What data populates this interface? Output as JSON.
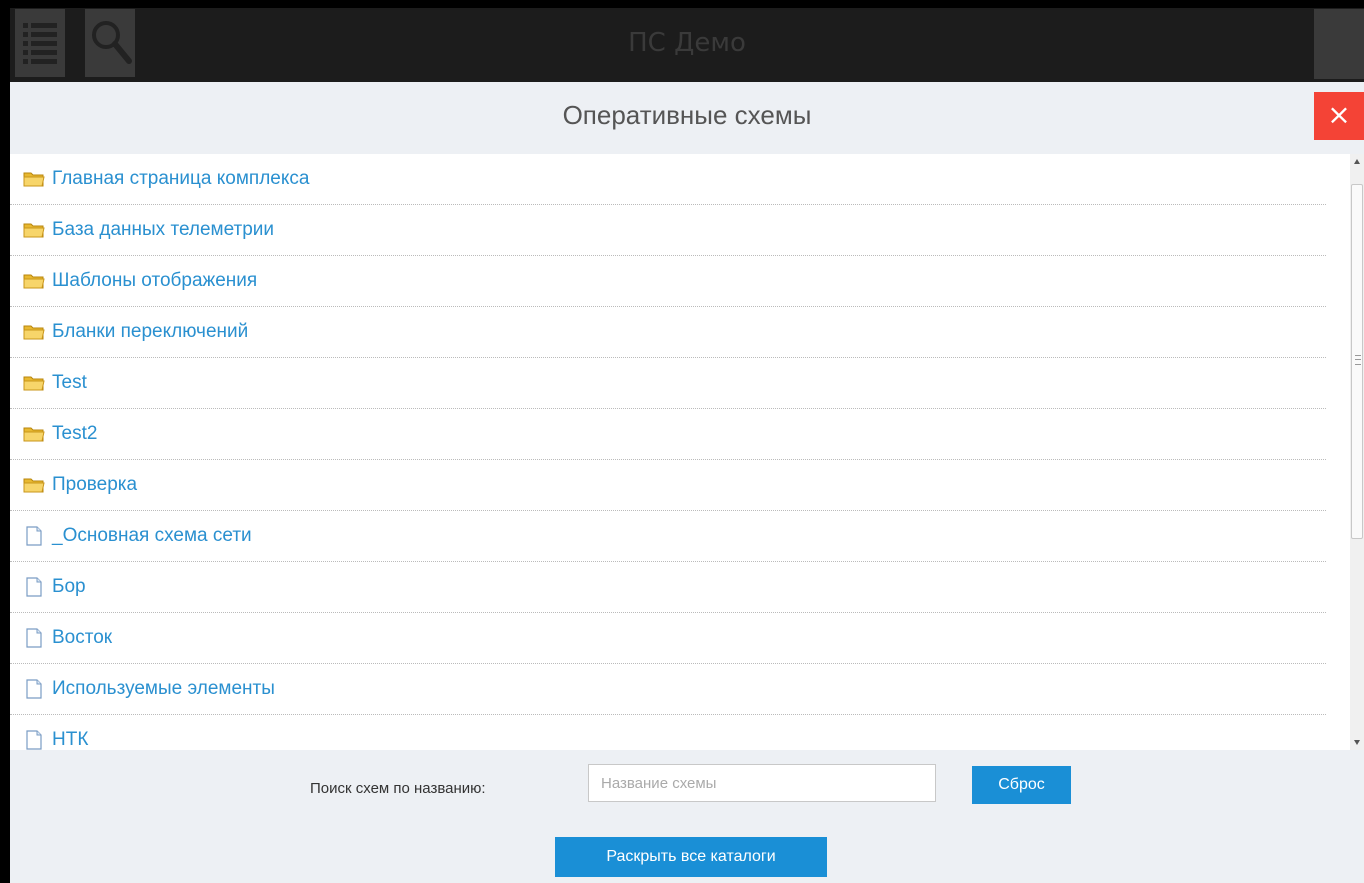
{
  "app": {
    "title": "ПС Демо"
  },
  "modal": {
    "title": "Оперативные схемы",
    "close_label": "×",
    "items": [
      {
        "type": "folder",
        "label": "Главная страница комплекса"
      },
      {
        "type": "folder",
        "label": "База данных телеметрии"
      },
      {
        "type": "folder",
        "label": "Шаблоны отображения"
      },
      {
        "type": "folder",
        "label": "Бланки переключений"
      },
      {
        "type": "folder",
        "label": "Test"
      },
      {
        "type": "folder",
        "label": "Test2"
      },
      {
        "type": "folder",
        "label": "Проверка"
      },
      {
        "type": "file",
        "label": "_Основная схема сети"
      },
      {
        "type": "file",
        "label": "Бор"
      },
      {
        "type": "file",
        "label": "Восток"
      },
      {
        "type": "file",
        "label": "Используемые элементы"
      },
      {
        "type": "file",
        "label": "НТК"
      }
    ]
  },
  "footer": {
    "search_label": "Поиск схем по названию:",
    "search_placeholder": "Название схемы",
    "search_value": "",
    "reset_label": "Сброс",
    "expand_label": "Раскрыть все каталоги"
  },
  "colors": {
    "accent": "#1a8fd6",
    "link": "#2a90d0",
    "close": "#f44336",
    "folder": "#f5c542"
  }
}
